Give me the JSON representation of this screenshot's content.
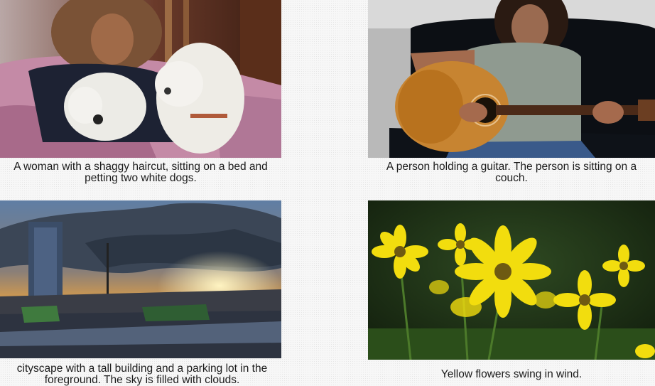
{
  "items": [
    {
      "image_subject": "woman-with-dogs",
      "caption_line1": "A woman with a shaggy haircut, sitting on a bed and",
      "caption_line2": "petting two white dogs."
    },
    {
      "image_subject": "person-with-guitar",
      "caption_line1": "A person holding a guitar. The person is sitting on a",
      "caption_line2": "couch."
    },
    {
      "image_subject": "cityscape-sunset",
      "caption_line1": "cityscape with a tall building and a parking lot in the",
      "caption_line2": "foreground. The sky is filled with clouds."
    },
    {
      "image_subject": "yellow-flowers",
      "caption_line1": "Yellow flowers swing in wind.",
      "caption_line2": ""
    }
  ],
  "colors": {
    "background": "#f7f7f7",
    "caption_text": "#1b1b1b"
  }
}
